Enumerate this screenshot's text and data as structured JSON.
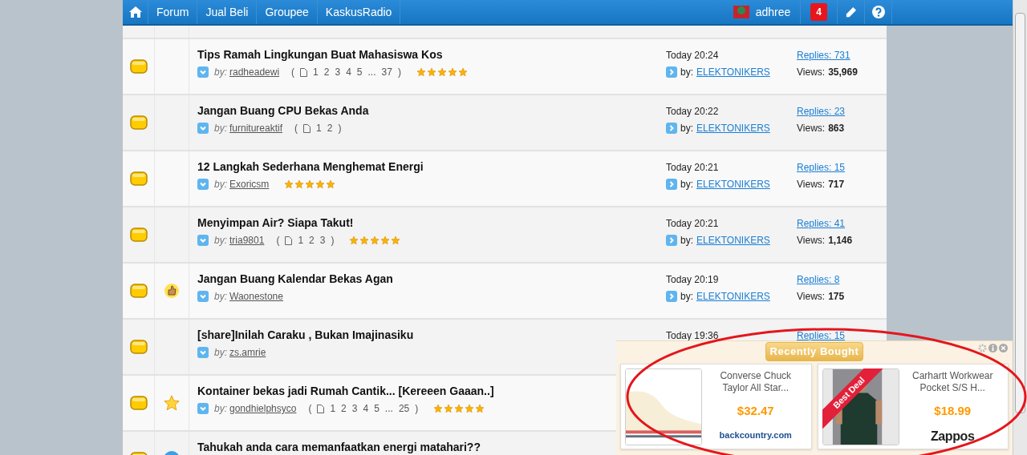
{
  "nav": {
    "items": [
      {
        "label": "Forum"
      },
      {
        "label": "Jual Beli"
      },
      {
        "label": "Groupee"
      },
      {
        "label": "KaskusRadio"
      }
    ],
    "user": "adhree",
    "notifications": "4"
  },
  "threads": [
    {
      "title": "Tips Ramah Lingkungan Buat Mahasiswa Kos",
      "by": "by:",
      "author": "radheadewi",
      "pages": {
        "open": "(",
        "items": [
          "1",
          "2",
          "3",
          "4",
          "5",
          "...",
          "37"
        ],
        "close": ")"
      },
      "stars": 5,
      "last_time": "Today 20:24",
      "last_by": "by:",
      "last_user": "ELEKTONIKERS",
      "replies": "Replies: 731",
      "views_label": "Views:",
      "views": "35,969"
    },
    {
      "title": "Jangan Buang CPU Bekas Anda",
      "by": "by:",
      "author": "furnitureaktif",
      "pages": {
        "open": "(",
        "items": [
          "1",
          "2"
        ],
        "close": ")"
      },
      "last_time": "Today 20:22",
      "last_by": "by:",
      "last_user": "ELEKTONIKERS",
      "replies": "Replies: 23",
      "views_label": "Views:",
      "views": "863"
    },
    {
      "title": "12 Langkah Sederhana Menghemat Energi",
      "by": "by:",
      "author": "Exoricsm",
      "stars": 5,
      "last_time": "Today 20:21",
      "last_by": "by:",
      "last_user": "ELEKTONIKERS",
      "replies": "Replies: 15",
      "views_label": "Views:",
      "views": "717"
    },
    {
      "title": "Menyimpan Air? Siapa Takut!",
      "by": "by:",
      "author": "tria9801",
      "pages": {
        "open": "(",
        "items": [
          "1",
          "2",
          "3"
        ],
        "close": ")"
      },
      "stars": 5,
      "last_time": "Today 20:21",
      "last_by": "by:",
      "last_user": "ELEKTONIKERS",
      "replies": "Replies: 41",
      "views_label": "Views:",
      "views": "1,146"
    },
    {
      "title": "Jangan Buang Kalendar Bekas Agan",
      "by": "by:",
      "author": "Waonestone",
      "badge": {
        "kind": "thumb"
      },
      "last_time": "Today 20:19",
      "last_by": "by:",
      "last_user": "ELEKTONIKERS",
      "replies": "Replies: 8",
      "views_label": "Views:",
      "views": "175"
    },
    {
      "title": "[share]Inilah Caraku , Bukan Imajinasiku",
      "by": "by:",
      "author": "zs.amrie",
      "last_time": "Today 19:36",
      "replies": "Replies: 15"
    },
    {
      "title": "Kontainer bekas jadi Rumah Cantik... [Kereeen Gaaan..]",
      "by": "by:",
      "author": "gondhielphsyco",
      "pages": {
        "open": "(",
        "items": [
          "1",
          "2",
          "3",
          "4",
          "5",
          "...",
          "25"
        ],
        "close": ")"
      },
      "stars": 5,
      "badge": {
        "kind": "star"
      }
    },
    {
      "title": "Tahukah anda cara memanfaatkan energi matahari??",
      "badge": {
        "kind": "smiley"
      }
    }
  ],
  "ad": {
    "header": "Recently Bought",
    "products": [
      {
        "name": "Converse Chuck Taylor All Star...",
        "price": "$32.47",
        "store": "backcountry.com",
        "kind": "shoe"
      },
      {
        "name": "Carhartt Workwear Pocket S/S H...",
        "price": "$18.99",
        "store": "Zappos",
        "ribbon": "Best Deal",
        "kind": "shirt"
      }
    ]
  }
}
